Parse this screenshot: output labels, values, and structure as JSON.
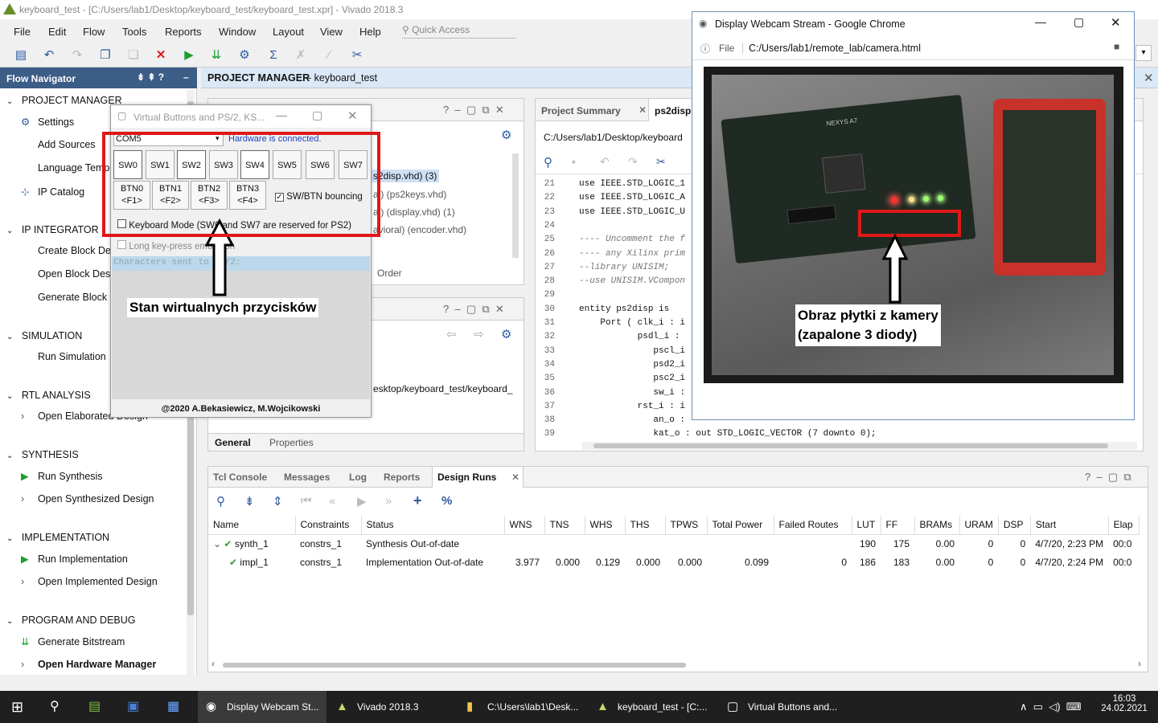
{
  "window": {
    "title": "keyboard_test - [C:/Users/lab1/Desktop/keyboard_test/keyboard_test.xpr] - Vivado 2018.3"
  },
  "menu": [
    "File",
    "Edit",
    "Flow",
    "Tools",
    "Reports",
    "Window",
    "Layout",
    "View",
    "Help"
  ],
  "quick_access": "Quick Access",
  "flow_nav": {
    "title": "Flow Navigator",
    "sections": [
      {
        "label": "PROJECT MANAGER",
        "items": [
          "Settings",
          "Add Sources",
          "Language Templates",
          "IP Catalog"
        ]
      },
      {
        "label": "IP INTEGRATOR",
        "items": [
          "Create Block Design",
          "Open Block Design",
          "Generate Block Design"
        ]
      },
      {
        "label": "SIMULATION",
        "items": [
          "Run Simulation"
        ]
      },
      {
        "label": "RTL ANALYSIS",
        "items": [
          "Open Elaborated Design"
        ]
      },
      {
        "label": "SYNTHESIS",
        "items": [
          "Run Synthesis",
          "Open Synthesized Design"
        ]
      },
      {
        "label": "IMPLEMENTATION",
        "items": [
          "Run Implementation",
          "Open Implemented Design"
        ]
      },
      {
        "label": "PROGRAM AND DEBUG",
        "items": [
          "Generate Bitstream",
          "Open Hardware Manager"
        ]
      }
    ]
  },
  "pm_header": {
    "title": "PROJECT MANAGER",
    "project": "- keyboard_test"
  },
  "sources": {
    "files": [
      "s2disp.vhd) (3)",
      "al) (ps2keys.vhd)",
      "al) (display.vhd) (1)",
      "avioral) (encoder.vhd)"
    ],
    "order": "Order",
    "path": "esktop/keyboard_test/keyboard_",
    "tabs": [
      "General",
      "Properties"
    ]
  },
  "editor": {
    "tabs": [
      "Project Summary",
      "ps2disp"
    ],
    "path": "C:/Users/lab1/Desktop/keyboard",
    "lines": [
      {
        "n": "21",
        "t": "use IEEE.STD_LOGIC_1"
      },
      {
        "n": "22",
        "t": "use IEEE.STD_LOGIC_A"
      },
      {
        "n": "23",
        "t": "use IEEE.STD_LOGIC_U"
      },
      {
        "n": "24",
        "t": ""
      },
      {
        "n": "25",
        "t": "---- Uncomment the f"
      },
      {
        "n": "26",
        "t": "---- any Xilinx prim"
      },
      {
        "n": "27",
        "t": "--library UNISIM;"
      },
      {
        "n": "28",
        "t": "--use UNISIM.VCompon"
      },
      {
        "n": "29",
        "t": ""
      },
      {
        "n": "30",
        "t": "entity ps2disp is"
      },
      {
        "n": "31",
        "t": "    Port ( clk_i : i"
      },
      {
        "n": "32",
        "t": "           psdl_i :"
      },
      {
        "n": "33",
        "t": "              pscl_i"
      },
      {
        "n": "34",
        "t": "              psd2_i"
      },
      {
        "n": "35",
        "t": "              psc2_i"
      },
      {
        "n": "36",
        "t": "              sw_i :"
      },
      {
        "n": "37",
        "t": "           rst_i : i"
      },
      {
        "n": "38",
        "t": "              an_o :"
      },
      {
        "n": "39",
        "t": "              kat_o : out STD_LOGIC_VECTOR (7 downto 0);"
      }
    ]
  },
  "vbuttons": {
    "title": "Virtual Buttons and PS/2, KS...",
    "port": "COM5",
    "status": "Hardware is connected.",
    "switches": [
      "SW0",
      "SW1",
      "SW2",
      "SW3",
      "SW4",
      "SW5",
      "SW6",
      "SW7"
    ],
    "buttons": [
      {
        "a": "BTN0",
        "b": "<F1>"
      },
      {
        "a": "BTN1",
        "b": "<F2>"
      },
      {
        "a": "BTN2",
        "b": "<F3>"
      },
      {
        "a": "BTN3",
        "b": "<F4>"
      }
    ],
    "bouncing": "SW/BTN bouncing",
    "keyboard_mode": "Keyboard Mode (SW6 and SW7 are reserved for PS2)",
    "long_press": "Long key-press emulation",
    "chars": "Characters sent to PS/2:",
    "caption": "Stan wirtualnych przycisków",
    "footer": "@2020 A.Bekasiewicz, M.Wojcikowski"
  },
  "chrome": {
    "title": "Display Webcam Stream - Google Chrome",
    "file": "File",
    "url": "C:/Users/lab1/remote_lab/camera.html",
    "caption_line1": "Obraz płytki z kamery",
    "caption_line2": "(zapalone 3 diody)",
    "board_label": "NEXYS A7"
  },
  "runs": {
    "tabs": [
      "Tcl Console",
      "Messages",
      "Log",
      "Reports",
      "Design Runs"
    ],
    "columns": [
      "Name",
      "Constraints",
      "Status",
      "WNS",
      "TNS",
      "WHS",
      "THS",
      "TPWS",
      "Total Power",
      "Failed Routes",
      "LUT",
      "FF",
      "BRAMs",
      "URAM",
      "DSP",
      "Start",
      "Elap"
    ],
    "rows": [
      [
        "synth_1",
        "constrs_1",
        "Synthesis Out-of-date",
        "",
        "",
        "",
        "",
        "",
        "",
        "",
        "190",
        "175",
        "0.00",
        "0",
        "0",
        "4/7/20, 2:23 PM",
        "00:0"
      ],
      [
        "impl_1",
        "constrs_1",
        "Implementation Out-of-date",
        "3.977",
        "0.000",
        "0.129",
        "0.000",
        "0.000",
        "0.099",
        "0",
        "186",
        "183",
        "0.00",
        "0",
        "0",
        "4/7/20, 2:24 PM",
        "00:0"
      ]
    ]
  },
  "taskbar": {
    "items": [
      "Display Webcam St...",
      "Vivado 2018.3",
      "C:\\Users\\lab1\\Desk...",
      "keyboard_test - [C:...",
      "Virtual Buttons and..."
    ],
    "time": "16:03",
    "date": "24.02.2021"
  }
}
